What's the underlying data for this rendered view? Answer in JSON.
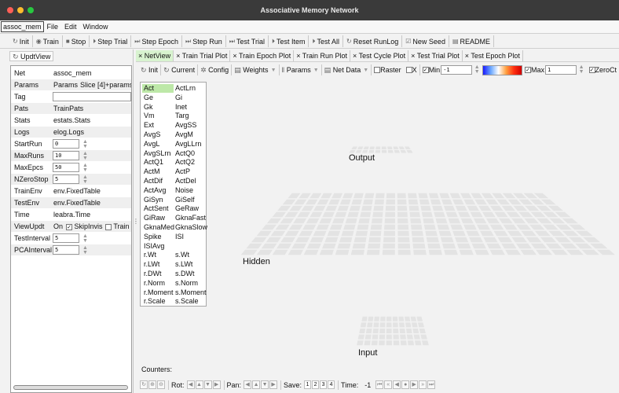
{
  "window": {
    "title": "Associative Memory Network"
  },
  "menubar": {
    "app": "assoc_mem",
    "items": [
      "File",
      "Edit",
      "Window"
    ]
  },
  "toolbar": {
    "buttons": [
      {
        "label": "Init",
        "icon": "reset-icon"
      },
      {
        "label": "Train",
        "icon": "play-icon"
      },
      {
        "label": "Stop",
        "icon": "stop-icon"
      },
      {
        "label": "Step Trial",
        "icon": "step-icon"
      },
      {
        "label": "Step Epoch",
        "icon": "step-double-icon"
      },
      {
        "label": "Step Run",
        "icon": "step-double-icon"
      },
      {
        "label": "Test Trial",
        "icon": "step-double-icon"
      },
      {
        "label": "Test Item",
        "icon": "step-icon"
      },
      {
        "label": "Test All",
        "icon": "step-icon"
      },
      {
        "label": "Reset RunLog",
        "icon": "reset-icon"
      },
      {
        "label": "New Seed",
        "icon": "checkbox-icon"
      },
      {
        "label": "README",
        "icon": "file-icon"
      }
    ]
  },
  "left": {
    "updt_label": "UpdtView",
    "rows": [
      {
        "label": "Net",
        "value": "assoc_mem"
      },
      {
        "label": "Params",
        "value": "Params",
        "extra": "Slice [4]+params."
      },
      {
        "label": "Tag",
        "value": ""
      },
      {
        "label": "Pats",
        "value": "TrainPats"
      },
      {
        "label": "Stats",
        "value": "estats.Stats"
      },
      {
        "label": "Logs",
        "value": "elog.Logs"
      },
      {
        "label": "StartRun",
        "value": "0"
      },
      {
        "label": "MaxRuns",
        "value": "10"
      },
      {
        "label": "MaxEpcs",
        "value": "50"
      },
      {
        "label": "NZeroStop",
        "value": "5"
      },
      {
        "label": "TrainEnv",
        "value": "env.FixedTable"
      },
      {
        "label": "TestEnv",
        "value": "env.FixedTable"
      },
      {
        "label": "Time",
        "value": "leabra.Time"
      },
      {
        "label": "ViewUpdt",
        "value": "On",
        "check1": "SkipInvis",
        "check2": "Train"
      },
      {
        "label": "TestInterval",
        "value": "5"
      },
      {
        "label": "PCAInterval",
        "value": "5"
      }
    ]
  },
  "tabs": [
    "NetView",
    "Train Trial Plot",
    "Train Epoch Plot",
    "Train Run Plot",
    "Test Cycle Plot",
    "Test Trial Plot",
    "Test Epoch Plot"
  ],
  "netbar": {
    "init": "Init",
    "current": "Current",
    "config": "Config",
    "weights": "Weights",
    "params": "Params",
    "net_data": "Net Data",
    "raster": "Raster",
    "x": "X",
    "min_label": "Min",
    "min_value": "-1",
    "max_label": "Max",
    "max_value": "1",
    "zeroctr": "ZeroCt"
  },
  "vars": [
    [
      "Act",
      "ActLrn"
    ],
    [
      "Ge",
      "Gi"
    ],
    [
      "Gk",
      "Inet"
    ],
    [
      "Vm",
      "Targ"
    ],
    [
      "Ext",
      "AvgSS"
    ],
    [
      "AvgS",
      "AvgM"
    ],
    [
      "AvgL",
      "AvgLLrn"
    ],
    [
      "AvgSLrn",
      "ActQ0"
    ],
    [
      "ActQ1",
      "ActQ2"
    ],
    [
      "ActM",
      "ActP"
    ],
    [
      "ActDif",
      "ActDel"
    ],
    [
      "ActAvg",
      "Noise"
    ],
    [
      "GiSyn",
      "GiSelf"
    ],
    [
      "ActSent",
      "GeRaw"
    ],
    [
      "GiRaw",
      "GknaFast"
    ],
    [
      "GknaMed",
      "GknaSlow"
    ],
    [
      "Spike",
      "ISI"
    ],
    [
      "ISIAvg",
      ""
    ],
    [
      "r.Wt",
      "s.Wt"
    ],
    [
      "r.LWt",
      "s.LWt"
    ],
    [
      "r.DWt",
      "s.DWt"
    ],
    [
      "r.Norm",
      "s.Norm"
    ],
    [
      "r.Moment",
      "s.Moment"
    ],
    [
      "r.Scale",
      "s.Scale"
    ]
  ],
  "layers": {
    "output": "Output",
    "hidden": "Hidden",
    "input": "Input"
  },
  "counters_label": "Counters:",
  "bottombar": {
    "rot": "Rot:",
    "pan": "Pan:",
    "save": "Save:",
    "save_slots": [
      "1",
      "2",
      "3",
      "4"
    ],
    "time": "Time:",
    "time_value": "-1"
  },
  "colors": {
    "active_tab": "#d8f3cf",
    "selected_var": "#bde8a8",
    "grid_cell": "#e3e3e3",
    "titlebar": "#3a3a3a"
  }
}
